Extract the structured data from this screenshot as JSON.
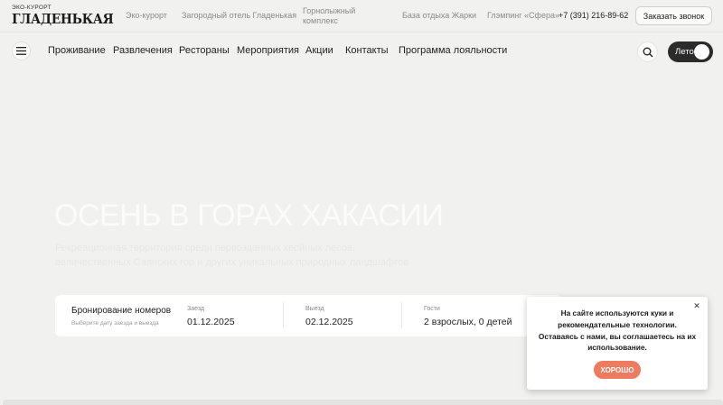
{
  "header": {
    "logo_small": "ЭКО-КУРОРТ",
    "logo_big": "ГЛАДЕНЬКАЯ",
    "links": [
      "Эко-курорт",
      "Загородный отель Гладенькая",
      "Горнолыжный комплекс",
      "База отдыха Жарки",
      "Глэмпинг «Сфера»"
    ],
    "phone": "+7 (391) 216-89-62",
    "call_button": "Заказать звонок"
  },
  "nav": {
    "menu_icon": "hamburger-icon",
    "items": [
      "Проживание",
      "Развлечения",
      "Рестораны",
      "Мероприятия",
      "Акции",
      "Контакты",
      "Программа лояльности"
    ],
    "search_icon": "search-icon",
    "season_label": "Лето"
  },
  "hero": {
    "title": "ОСЕНЬ В ГОРАХ ХАКАСИИ",
    "subtitle": "Рекреационная территория среди первозданных хвойных лесов, величественных Саянских гор и других уникальных природных ландшафтов"
  },
  "booking": {
    "title": "Бронирование номеров",
    "subtitle": "Выберите дату заезда и выезда",
    "checkin_label": "Заезд",
    "checkin_value": "01.12.2025",
    "checkout_label": "Выезд",
    "checkout_value": "02.12.2025",
    "guests_label": "Гости",
    "guests_value": "2 взрослых, 0 детей"
  },
  "cookie": {
    "text": "На сайте используются куки и рекомендательные технологии. Оставаясь с нами, вы соглашаетесь на их использование.",
    "button": "ХОРОШО",
    "close_icon": "close-icon"
  },
  "colors": {
    "accent": "#ee7b5f",
    "toggle_bg": "#2b2b2b",
    "page_bg": "#f1f1ef"
  }
}
